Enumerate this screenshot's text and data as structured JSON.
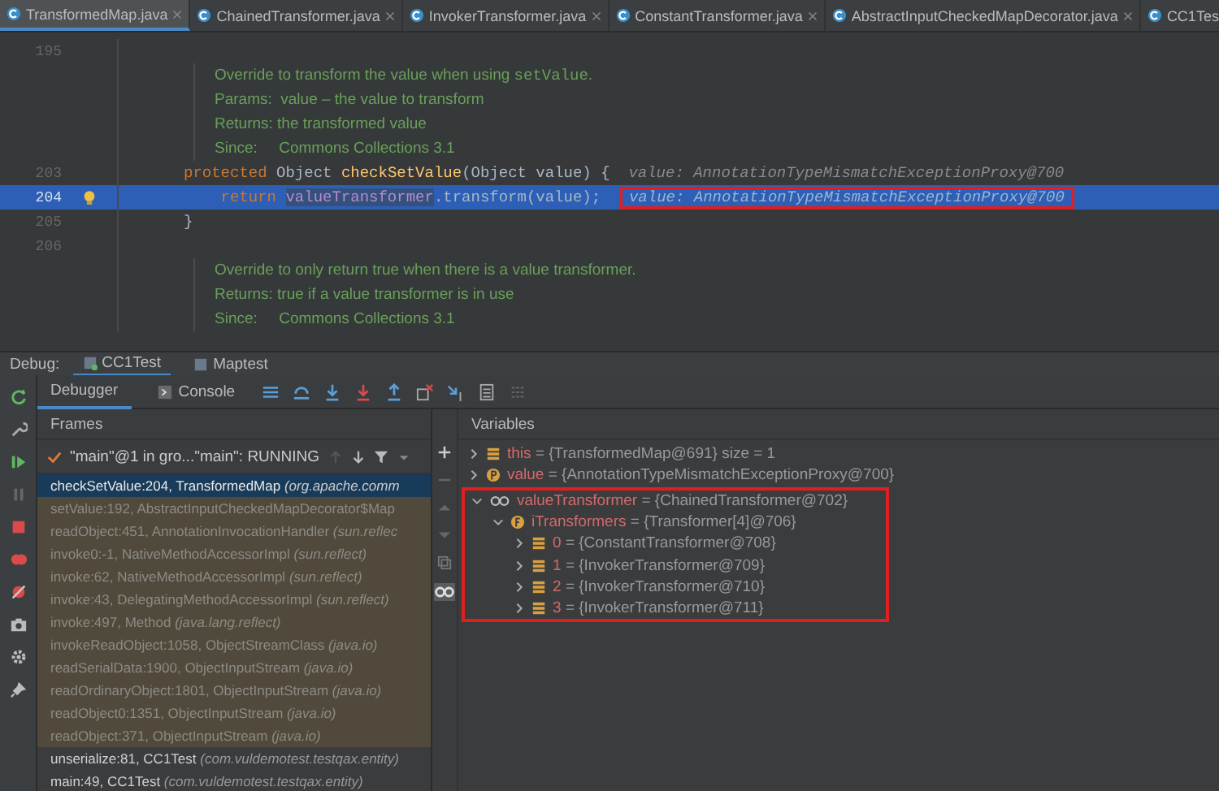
{
  "editor_tabs": [
    {
      "label": "TransformedMap.java",
      "selected": true
    },
    {
      "label": "ChainedTransformer.java",
      "selected": false
    },
    {
      "label": "InvokerTransformer.java",
      "selected": false
    },
    {
      "label": "ConstantTransformer.java",
      "selected": false
    },
    {
      "label": "AbstractInputCheckedMapDecorator.java",
      "selected": false
    },
    {
      "label": "CC1Tes",
      "selected": false
    }
  ],
  "editor": {
    "lines": [
      {
        "kind": "code",
        "number": "195",
        "current": false
      },
      {
        "kind": "doc",
        "parts": [
          {
            "kind": "doc",
            "text": "Override to transform the value when using "
          },
          {
            "kind": "doccode",
            "text": "setValue"
          },
          {
            "kind": "doc",
            "text": "."
          }
        ]
      },
      {
        "kind": "doc",
        "parts": [
          {
            "kind": "doc",
            "text": "Params:  value – the value to transform"
          }
        ]
      },
      {
        "kind": "doc",
        "parts": [
          {
            "kind": "doc",
            "text": "Returns: the transformed value"
          }
        ]
      },
      {
        "kind": "doc",
        "parts": [
          {
            "kind": "doc",
            "text": "Since:     Commons Collections 3.1"
          }
        ]
      },
      {
        "kind": "code",
        "number": "203",
        "current": false,
        "parts": [
          {
            "kind": "kw",
            "text": "protected "
          },
          {
            "kind": "plain",
            "text": "Object "
          },
          {
            "kind": "method",
            "text": "checkSetValue"
          },
          {
            "kind": "plain",
            "text": "(Object value) {  "
          },
          {
            "kind": "hint",
            "text": "value: AnnotationTypeMismatchExceptionProxy@700",
            "boxed": false
          }
        ]
      },
      {
        "kind": "code",
        "number": "204",
        "current": true,
        "parts": [
          {
            "kind": "kw",
            "text": "    return "
          },
          {
            "kind": "field",
            "text": "valueTransformer"
          },
          {
            "kind": "plain",
            "text": ".transform(value);  "
          },
          {
            "kind": "hint",
            "text": "value: AnnotationTypeMismatchExceptionProxy@700",
            "boxed": true
          }
        ]
      },
      {
        "kind": "code",
        "number": "205",
        "current": false,
        "parts": [
          {
            "kind": "plain",
            "text": "}"
          }
        ]
      },
      {
        "kind": "code",
        "number": "206",
        "current": false
      },
      {
        "kind": "doc",
        "parts": [
          {
            "kind": "doc",
            "text": "Override to only return true when there is a value transformer."
          }
        ]
      },
      {
        "kind": "doc",
        "parts": [
          {
            "kind": "doc",
            "text": "Returns: true if a value transformer is in use"
          }
        ]
      },
      {
        "kind": "doc",
        "parts": [
          {
            "kind": "doc",
            "text": "Since:     Commons Collections 3.1"
          }
        ]
      }
    ]
  },
  "debug_bar": {
    "label": "Debug:",
    "tabs": [
      {
        "label": "CC1Test",
        "selected": true
      },
      {
        "label": "Maptest",
        "selected": false
      }
    ]
  },
  "debugger_tabs": [
    {
      "label": "Debugger",
      "selected": true
    },
    {
      "label": "Console",
      "selected": false
    }
  ],
  "frames": {
    "title": "Frames",
    "thread": "\"main\"@1 in gro...\"main\": RUNNING",
    "items": [
      {
        "method": "checkSetValue:204, TransformedMap",
        "package": "(org.apache.comm",
        "selected": true,
        "library": false
      },
      {
        "method": "setValue:192, AbstractInputCheckedMapDecorator$Map",
        "selected": false,
        "library": true
      },
      {
        "method": "readObject:451, AnnotationInvocationHandler",
        "package": "(sun.reflec",
        "selected": false,
        "library": true
      },
      {
        "method": "invoke0:-1, NativeMethodAccessorImpl",
        "package": "(sun.reflect)",
        "selected": false,
        "library": true
      },
      {
        "method": "invoke:62, NativeMethodAccessorImpl",
        "package": "(sun.reflect)",
        "selected": false,
        "library": true
      },
      {
        "method": "invoke:43, DelegatingMethodAccessorImpl",
        "package": "(sun.reflect)",
        "selected": false,
        "library": true
      },
      {
        "method": "invoke:497, Method",
        "package": "(java.lang.reflect)",
        "selected": false,
        "library": true
      },
      {
        "method": "invokeReadObject:1058, ObjectStreamClass",
        "package": "(java.io)",
        "selected": false,
        "library": true
      },
      {
        "method": "readSerialData:1900, ObjectInputStream",
        "package": "(java.io)",
        "selected": false,
        "library": true
      },
      {
        "method": "readOrdinaryObject:1801, ObjectInputStream",
        "package": "(java.io)",
        "selected": false,
        "library": true
      },
      {
        "method": "readObject0:1351, ObjectInputStream",
        "package": "(java.io)",
        "selected": false,
        "library": true
      },
      {
        "method": "readObject:371, ObjectInputStream",
        "package": "(java.io)",
        "selected": false,
        "library": true
      },
      {
        "method": "unserialize:81, CC1Test",
        "package": "(com.vuldemotest.testqax.entity)",
        "selected": false,
        "library": false
      },
      {
        "method": "main:49, CC1Test",
        "package": "(com.vuldemotest.testqax.entity)",
        "selected": false,
        "library": false
      }
    ]
  },
  "variables": {
    "title": "Variables",
    "items": [
      {
        "kind": "field",
        "name": "this",
        "value": "= {TransformedMap@691}  size = 1",
        "expanded": false,
        "boxed": false
      },
      {
        "kind": "parameter",
        "name": "value",
        "value": "= {AnnotationTypeMismatchExceptionProxy@700}",
        "expanded": false,
        "boxed": false
      },
      {
        "kind": "watch",
        "name": "valueTransformer",
        "value": "= {ChainedTransformer@702}",
        "expanded": true,
        "boxed": true,
        "children": [
          {
            "kind": "final",
            "name": "iTransformers",
            "value": "= {Transformer[4]@706}",
            "expanded": true,
            "boxed": false,
            "children": [
              {
                "kind": "field",
                "name": "0",
                "value": "= {ConstantTransformer@708}",
                "expanded": false,
                "boxed": false
              },
              {
                "kind": "field",
                "name": "1",
                "value": "= {InvokerTransformer@709}",
                "expanded": false,
                "boxed": false
              },
              {
                "kind": "field",
                "name": "2",
                "value": "= {InvokerTransformer@710}",
                "expanded": false,
                "boxed": false
              },
              {
                "kind": "field",
                "name": "3",
                "value": "= {InvokerTransformer@711}",
                "expanded": false,
                "boxed": false
              }
            ]
          }
        ]
      }
    ]
  }
}
